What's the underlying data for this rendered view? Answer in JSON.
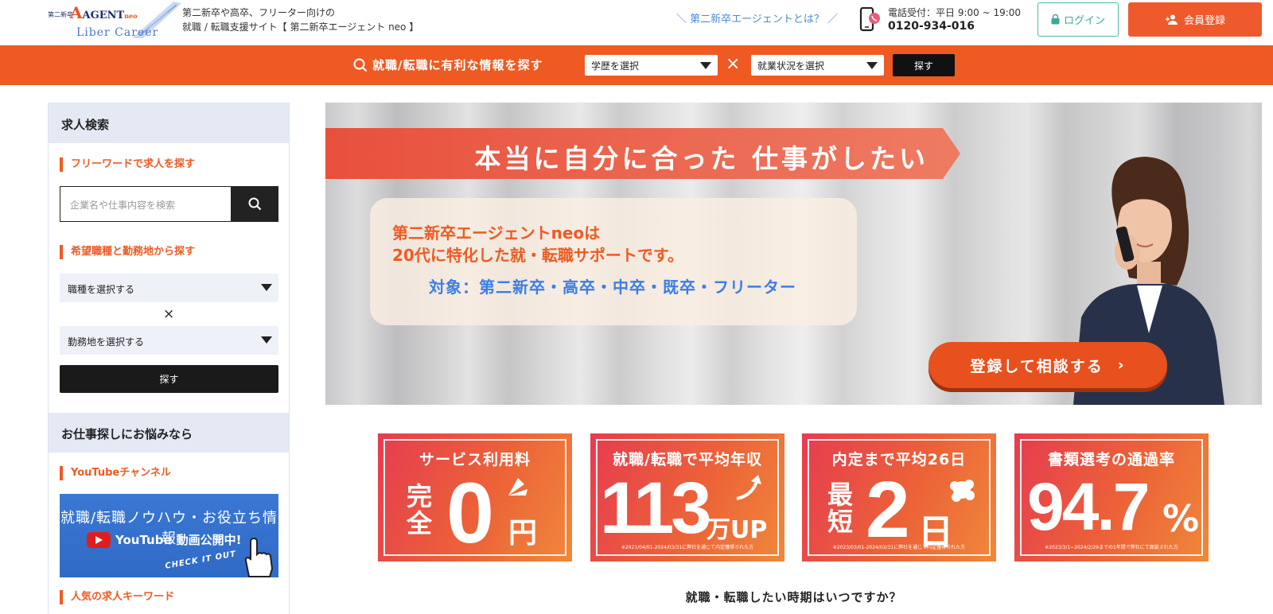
{
  "header": {
    "logo_small": "第二新卒",
    "logo_agent": "AGENT",
    "logo_neo": "neo",
    "logo_liber": "Liber Career",
    "tagline_1": "第二新卒や高卒、フリーター向けの",
    "tagline_2": "就職 / 転職支援サイト【 第二新卒エージェント neo 】",
    "about_link": "＼ 第二新卒エージェントとは？ ／",
    "phone_hours": "電話受付：平日 9:00 ~ 19:00",
    "phone_number": "0120-934-016",
    "login_label": "ログイン",
    "register_label": "会員登録",
    "phone_icon": "smartphone-icon",
    "lock_icon": "lock-icon",
    "user_add_icon": "user-add-icon"
  },
  "searchbar": {
    "title": "就職/転職に有利な情報を探す",
    "education_select": "学歴を選択",
    "status_select": "就業状況を選択",
    "times": "×",
    "button": "探す",
    "search_icon": "search-icon"
  },
  "sidebar": {
    "heading": "求人検索",
    "freeword_title": "フリーワードで求人を探す",
    "freeword_placeholder": "企業名や仕事内容を検索",
    "job_area_title": "希望職種と勤務地から探す",
    "job_select": "職種を選択する",
    "times": "×",
    "area_select": "勤務地を選択する",
    "search_button": "探す",
    "heading2": "お仕事探しにお悩みなら",
    "youtube_title": "YouTubeチャンネル",
    "youtube_banner_line1": "就職/転職ノウハウ・お役立ち情報",
    "youtube_banner_brand": "YouTube",
    "youtube_banner_line2": "動画公開中!",
    "youtube_banner_check": "CHECK IT OUT",
    "keyword_title": "人気の求人キーワード"
  },
  "hero": {
    "ribbon": "本当に自分に合った 仕事がしたい",
    "line1": "第二新卒エージェントneoは",
    "line2": "20代に特化した就・転職サポートです。",
    "line3": "対象：第二新卒・高卒・中卒・既卒・フリーター",
    "cta": "登録して相談する",
    "cta_arrow": "›",
    "accent": "#ee5a22"
  },
  "stats": [
    {
      "caption": "サービス利用料",
      "vert": "完全",
      "big": "0",
      "unit": "円",
      "note": ""
    },
    {
      "caption": "就職/転職で平均年収",
      "big": "113",
      "unit": "万UP",
      "note": "※2021/04/01-2024/03/31に弊社を通じて内定獲得された方"
    },
    {
      "caption": "内定まで平均26日",
      "vert": "最短",
      "big": "2",
      "unit": "日",
      "note": "※2023/03/01-2024/02/31に弊社を通じて内定獲得された方"
    },
    {
      "caption": "書類選考の通過率",
      "big": "94.7",
      "unit": "%",
      "note": "※2023/3/1~2024/2/29までの1年間で弊社にて面談された方"
    }
  ],
  "question": "就職・転職したい時期はいつですか？"
}
